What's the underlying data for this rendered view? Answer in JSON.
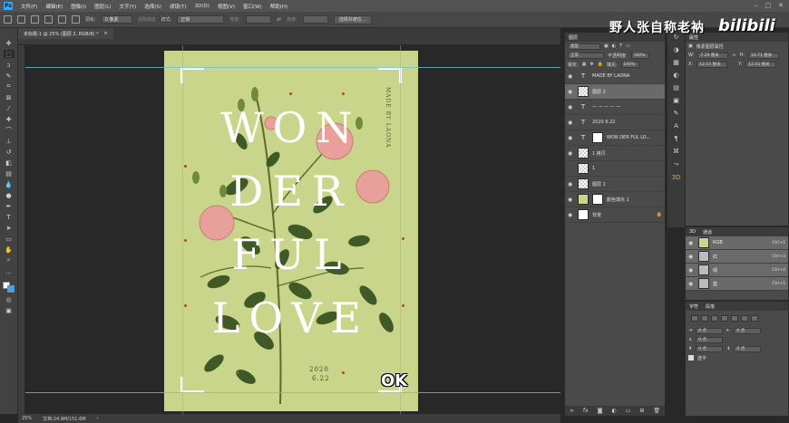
{
  "menubar": {
    "items": [
      "文件(F)",
      "编辑(E)",
      "图像(I)",
      "图层(L)",
      "文字(Y)",
      "选择(S)",
      "滤镜(T)",
      "3D(D)",
      "视图(V)",
      "窗口(W)",
      "帮助(H)"
    ]
  },
  "optionsbar": {
    "feather_label": "羽化:",
    "feather_value": "0 像素",
    "antialias_label": "消除锯齿",
    "style_label": "样式:",
    "style_value": "正常",
    "width_label": "宽度:",
    "height_label": "高度:",
    "select_mask_button": "选择并遮住..."
  },
  "document": {
    "tab_title": "未标题-1 @ 25% (图层 2, RGB/8) *",
    "zoom": "25%",
    "doc_size": "文档:24.9M/151.6M"
  },
  "poster": {
    "word_1": "WON",
    "word_2": "DER",
    "word_3": "FUL",
    "word_4": "LOVE",
    "side_text": "MADE BY LAONA",
    "date_year": "2020",
    "date_day": "6.22",
    "background_color": "#c9d58a"
  },
  "overlay": {
    "ok_text": "OK",
    "watermark_text": "野人张自称老衲",
    "bilibili_text": "bilibili"
  },
  "layers_panel": {
    "title": "图层",
    "filter_kind": "类型",
    "blend_mode": "正常",
    "opacity_label": "不透明度:",
    "opacity_value": "100%",
    "lock_label": "锁定:",
    "fill_label": "填充:",
    "fill_value": "100%",
    "layers": [
      {
        "name": "MADE BY LAONA",
        "kind": "text"
      },
      {
        "name": "图层 2",
        "kind": "image",
        "selected": true
      },
      {
        "name": "— — — — —",
        "kind": "text"
      },
      {
        "name": "2020 6.22",
        "kind": "text"
      },
      {
        "name": "WON DER FUL LO...",
        "kind": "text"
      },
      {
        "name": "1 拷贝",
        "kind": "image"
      },
      {
        "name": "1",
        "kind": "image"
      },
      {
        "name": "图层 1",
        "kind": "image"
      },
      {
        "name": "颜色填充 1",
        "kind": "fill"
      },
      {
        "name": "背景",
        "kind": "background"
      }
    ]
  },
  "properties_panel": {
    "title": "属性",
    "subtitle": "像素图层属性",
    "w_label": "W:",
    "w_value": "7.29 厘米",
    "h_label": "H:",
    "h_value": "10.71 厘米",
    "x_label": "X:",
    "x_value": "12.53 厘米",
    "y_label": "Y:",
    "y_value": "12.53 厘米"
  },
  "channels_panel": {
    "tab_1": "3D",
    "tab_2": "通道",
    "channels": [
      {
        "name": "RGB",
        "key": "Ctrl+2"
      },
      {
        "name": "红",
        "key": "Ctrl+3"
      },
      {
        "name": "绿",
        "key": "Ctrl+4"
      },
      {
        "name": "蓝",
        "key": "Ctrl+5"
      }
    ]
  },
  "paragraph_panel": {
    "tab_1": "字符",
    "tab_2": "段落",
    "indent_values": [
      "0 点",
      "0 点",
      "0 点",
      "0 点",
      "0 点"
    ],
    "hyphenate_label": "连字"
  }
}
